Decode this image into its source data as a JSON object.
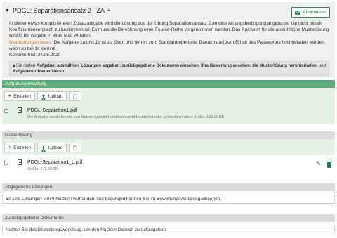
{
  "task": {
    "title": "PDGL: Separationsansatz 2 - ZA",
    "subscribe_label": "Abonnieren",
    "description": "In dieser etwas komplizierteren Zusatzaufgabe wird die Lösung aus der Übung Separationsansatz 2 an eine Anfangsbedingung angepasst, die nicht mittels Koeffizientenvergleich zu bestimmen ist. Es muss die Berechnung einer Fourier-Reihe vorgenommen werden. Das Passwort für die ausführliche Musterlösung wird in bei Abgabe in einer Mail verraten.",
    "hint_label": "Bearbeitungshinweis:",
    "hint_text": " Die Aufgabe 1a und 1b ist zu lösen und gehört zum Standardrepertoire. Danach darf zum Erhalt des Passwortes hochgeladen werden, wenn es bei 1c klemmt.",
    "deadline": "Korrekturfrist: 24.05.2020",
    "rights_prefix": "Sie dürfen ",
    "rights_bold": "Aufgaben auswählen, Lösungen abgeben, zurückgegebene Dokumente einsehen, Ihre Bewertung ansehen, die Musterlösung herunterladen",
    "rights_mid": ", und ",
    "rights_bold2": "Aufgabenordner editieren",
    "rights_end": "."
  },
  "aufgabenverwaltung": {
    "header": "Aufgabenverwaltung",
    "create_label": "Erstellen",
    "upload_label": "Upload",
    "file": {
      "name": "PDGL-Separation1.pdf",
      "meta": "Die Aufgabe wurde bereits von Nutzern gewählt und kann nicht bearbeitet oder gelöscht werden. Größe: 162,6KBB"
    }
  },
  "musterloesung": {
    "header": "Musterlösung",
    "create_label": "Erstellen",
    "upload_label": "Upload",
    "file": {
      "name": "PDGL-Separation1_L.pdf",
      "meta": "Größe: 272,6KBB"
    }
  },
  "abgegebene": {
    "header": "Abgegebene Lösungen",
    "text": "Es sind Lösungen von 9 Nutzern vorhanden. Die Lösungen können Sie im Bewertungswerkzeug einsehen."
  },
  "zurueckgegebene": {
    "header": "Zurückgegebene Dokumente",
    "text": "Nutzen Sie das Bewertungswerkzeug, um den Nutzern Dateien zurückzugeben."
  },
  "icons": {
    "caret": "caret-down-icon",
    "lock": "lock-icon",
    "subscribe": "envelope-icon",
    "create": "plus-icon",
    "upload": "upload-icon",
    "delete": "trash-icon",
    "file": "pdf-file-icon",
    "edit": "pencil-icon"
  },
  "colors": {
    "accent_green": "#5eae7c",
    "button_green": "#2e7d4f",
    "hint_orange": "#d9822b",
    "panel_grey": "#f0f0f0",
    "zone_green": "#e4f1e4"
  }
}
